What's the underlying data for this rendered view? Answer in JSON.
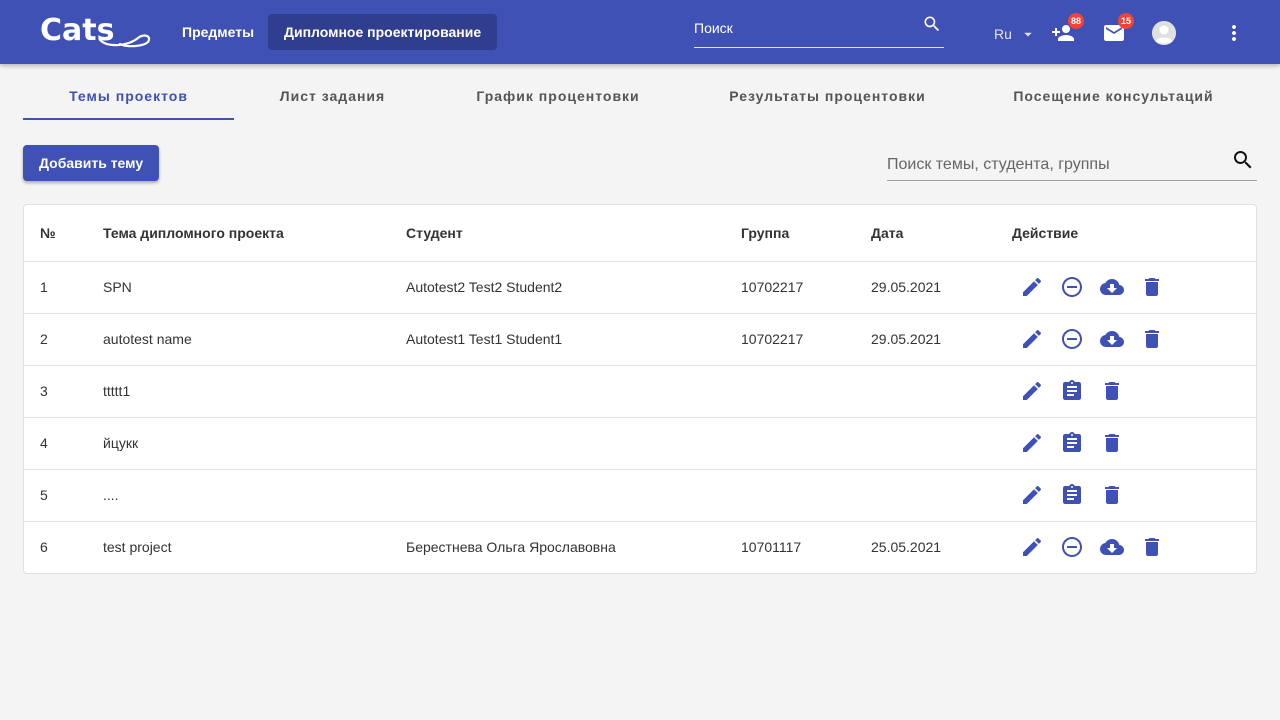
{
  "header": {
    "logo_text": "Cats",
    "nav": [
      "Предметы",
      "Дипломное проектирование"
    ],
    "search_placeholder": "Поиск",
    "lang": "Ru",
    "requests_badge": "88",
    "messages_badge": "15"
  },
  "tabs": [
    "Темы проектов",
    "Лист задания",
    "График процентовки",
    "Результаты процентовки",
    "Посещение консультаций"
  ],
  "toolbar": {
    "add_label": "Добавить тему",
    "search_placeholder": "Поиск темы, студента, группы"
  },
  "table": {
    "columns": [
      "№",
      "Тема дипломного проекта",
      "Студент",
      "Группа",
      "Дата",
      "Действие"
    ],
    "rows": [
      {
        "num": "1",
        "topic": "SPN",
        "student": "Autotest2 Test2 Student2",
        "group": "10702217",
        "date": "29.05.2021",
        "actions": [
          "edit-icon",
          "remove-circle-icon",
          "cloud-download-icon",
          "delete-icon"
        ]
      },
      {
        "num": "2",
        "topic": "autotest name",
        "student": "Autotest1 Test1 Student1",
        "group": "10702217",
        "date": "29.05.2021",
        "actions": [
          "edit-icon",
          "remove-circle-icon",
          "cloud-download-icon",
          "delete-icon"
        ]
      },
      {
        "num": "3",
        "topic": "ttttt1",
        "student": "",
        "group": "",
        "date": "",
        "actions": [
          "edit-icon",
          "assignment-icon",
          "delete-icon"
        ]
      },
      {
        "num": "4",
        "topic": "йцукк",
        "student": "",
        "group": "",
        "date": "",
        "actions": [
          "edit-icon",
          "assignment-icon",
          "delete-icon"
        ]
      },
      {
        "num": "5",
        "topic": "....",
        "student": "",
        "group": "",
        "date": "",
        "actions": [
          "edit-icon",
          "assignment-icon",
          "delete-icon"
        ]
      },
      {
        "num": "6",
        "topic": "test project",
        "student": "Берестнева Ольга Ярославовна",
        "group": "10701117",
        "date": "25.05.2021",
        "actions": [
          "edit-icon",
          "remove-circle-icon",
          "cloud-download-icon",
          "delete-icon"
        ]
      }
    ]
  },
  "colors": {
    "primary": "#3f51b5",
    "badge": "#f44336"
  }
}
